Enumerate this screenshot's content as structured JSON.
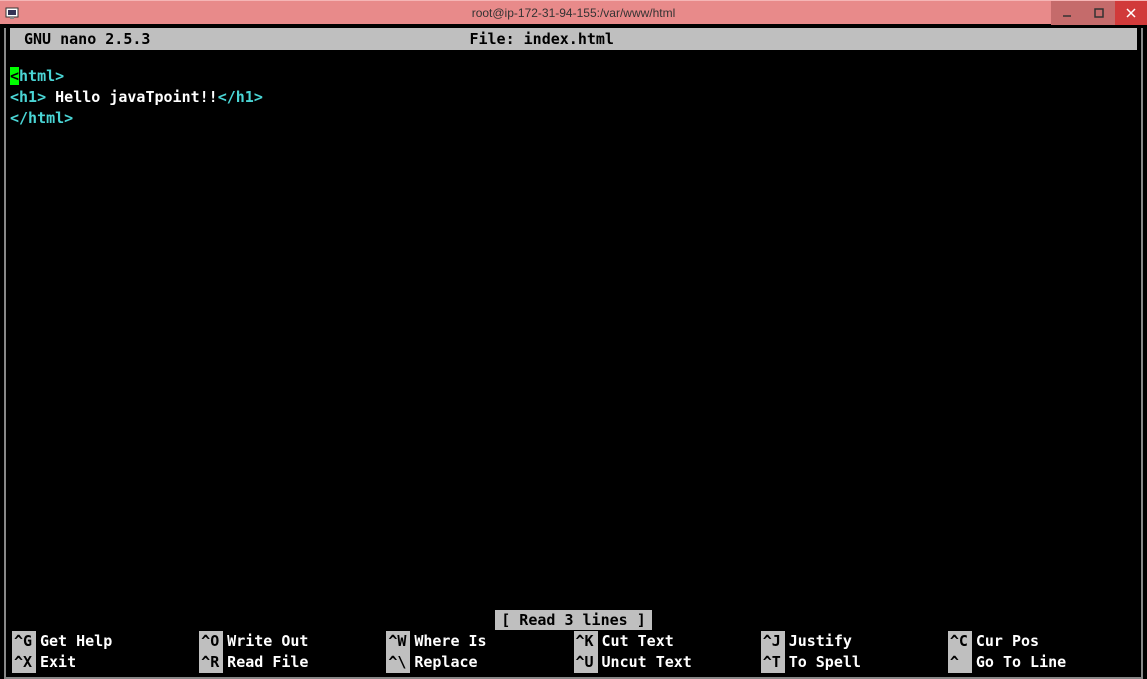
{
  "window": {
    "title": "root@ip-172-31-94-155:/var/www/html"
  },
  "nano": {
    "app_label": "GNU nano 2.5.3",
    "file_label": "File: index.html",
    "status": "[ Read 3 lines ]"
  },
  "content": {
    "line1_cursor": "<",
    "line1_rest": "html>",
    "line2_open": "<h1>",
    "line2_text": " Hello javaTpoint!!",
    "line2_close": "</h1>",
    "line3": "</html>"
  },
  "shortcuts": {
    "row1": [
      {
        "key": "^G",
        "label": "Get Help"
      },
      {
        "key": "^O",
        "label": "Write Out"
      },
      {
        "key": "^W",
        "label": "Where Is"
      },
      {
        "key": "^K",
        "label": "Cut Text"
      },
      {
        "key": "^J",
        "label": "Justify"
      },
      {
        "key": "^C",
        "label": "Cur Pos"
      }
    ],
    "row2": [
      {
        "key": "^X",
        "label": "Exit"
      },
      {
        "key": "^R",
        "label": "Read File"
      },
      {
        "key": "^\\",
        "label": "Replace"
      },
      {
        "key": "^U",
        "label": "Uncut Text"
      },
      {
        "key": "^T",
        "label": "To Spell"
      },
      {
        "key": "^ ",
        "label": "Go To Line"
      }
    ]
  }
}
